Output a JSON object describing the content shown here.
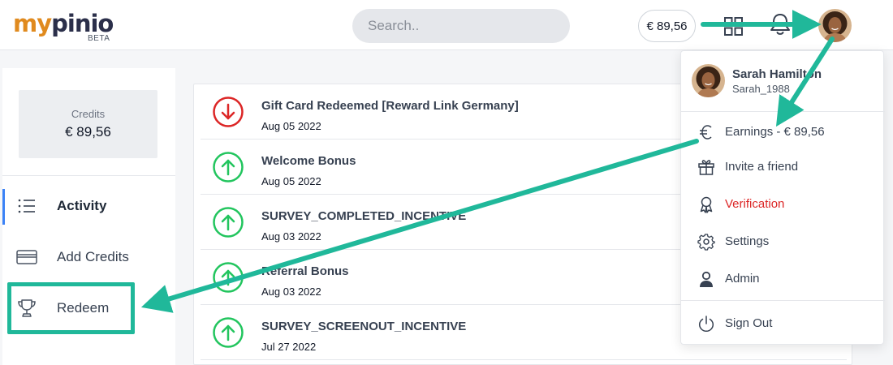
{
  "brand": {
    "logo_part1": "my",
    "logo_part2": "pinio",
    "badge": "BETA"
  },
  "header": {
    "search": {
      "placeholder": "Search..",
      "value": ""
    },
    "balance": "€ 89,56",
    "icons": [
      "grid-icon",
      "bell-icon"
    ],
    "avatar": "avatar"
  },
  "sidebar": {
    "credits_label": "Credits",
    "credits_value": "€ 89,56",
    "items": [
      {
        "label": "Activity",
        "icon": "list-icon",
        "active": true
      },
      {
        "label": "Add Credits",
        "icon": "credit-card-icon",
        "active": false
      },
      {
        "label": "Redeem",
        "icon": "trophy-icon",
        "active": false
      }
    ]
  },
  "transactions": [
    {
      "title": "Gift Card Redeemed [Reward Link Germany]",
      "date": "Aug 05 2022",
      "direction": "down",
      "icon": "arrow-down-circle-icon"
    },
    {
      "title": "Welcome Bonus",
      "date": "Aug 05 2022",
      "direction": "up",
      "icon": "arrow-up-circle-icon"
    },
    {
      "title": "SURVEY_COMPLETED_INCENTIVE",
      "date": "Aug 03 2022",
      "direction": "up",
      "icon": "arrow-up-circle-icon"
    },
    {
      "title": "Referral Bonus",
      "date": "Aug 03 2022",
      "direction": "up",
      "icon": "arrow-up-circle-icon"
    },
    {
      "title": "SURVEY_SCREENOUT_INCENTIVE",
      "date": "Jul 27 2022",
      "direction": "up",
      "icon": "arrow-up-circle-icon"
    }
  ],
  "user_menu": {
    "name": "Sarah Hamilton",
    "username": "Sarah_1988",
    "items": [
      {
        "label": "Earnings - € 89,56",
        "icon": "euro-icon"
      },
      {
        "label": "Invite a friend",
        "icon": "gift-icon"
      },
      {
        "label": "Verification",
        "icon": "badge-icon",
        "color": "#dc2626"
      },
      {
        "label": "Settings",
        "icon": "gear-icon"
      },
      {
        "label": "Admin",
        "icon": "user-icon"
      }
    ],
    "sign_out": {
      "label": "Sign Out",
      "icon": "power-icon"
    }
  },
  "colors": {
    "logo_orange": "#e08a1e",
    "logo_navy": "#2b2f4a",
    "accent_blue": "#3b82f6",
    "up_green": "#22c55e",
    "down_red": "#dc2626",
    "annotation_teal": "#20b89a"
  }
}
